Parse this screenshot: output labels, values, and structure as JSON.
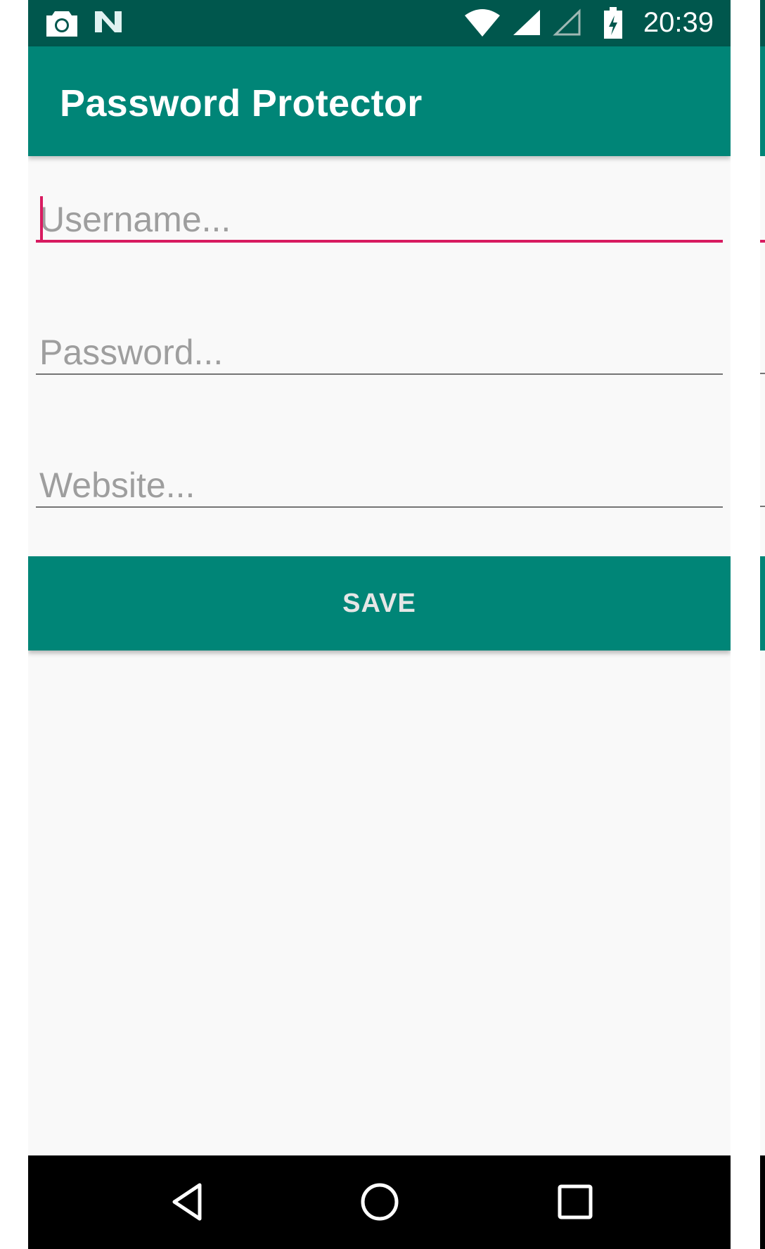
{
  "status_bar": {
    "time": "20:39",
    "left_icons": [
      "camera-icon",
      "n-notification-icon"
    ],
    "right_icons": [
      "wifi-icon",
      "signal-full-icon",
      "signal-empty-icon",
      "battery-charging-icon"
    ]
  },
  "app_bar": {
    "title": "Password Protector"
  },
  "form": {
    "username": {
      "placeholder": "Username...",
      "value": ""
    },
    "password": {
      "placeholder": "Password...",
      "value": ""
    },
    "website": {
      "placeholder": "Website...",
      "value": ""
    },
    "save_label": "SAVE"
  },
  "nav_bar": {
    "buttons": [
      "back-icon",
      "home-icon",
      "recents-icon"
    ]
  },
  "colors": {
    "status_bar": "#00574d",
    "primary": "#008577",
    "accent": "#d81b60",
    "background": "#f9f9f9",
    "nav_bar": "#000000"
  }
}
